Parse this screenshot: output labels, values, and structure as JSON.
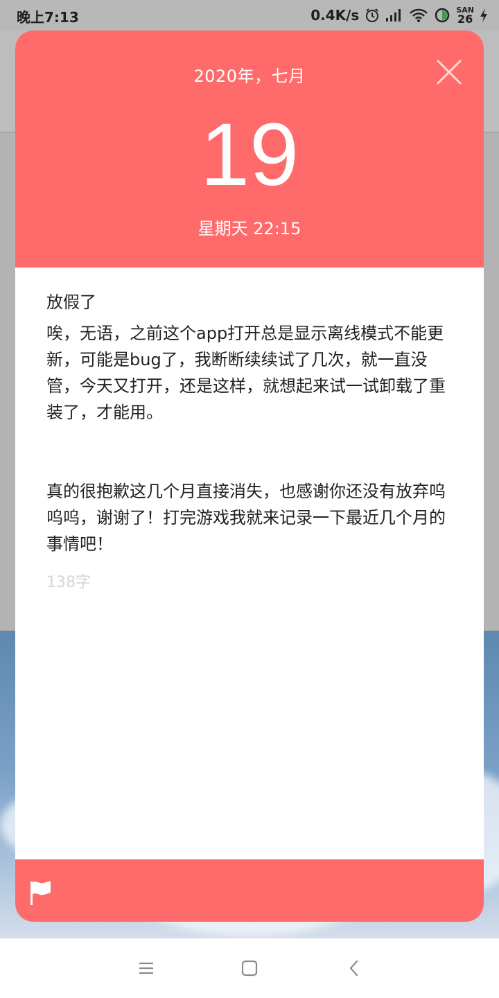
{
  "status_bar": {
    "time": "晚上7:13",
    "network_speed": "0.4K/s",
    "battery_label": "SAN",
    "battery_level": "26",
    "icons": [
      "alarm-icon",
      "signal-icon",
      "wifi-icon",
      "battery-icon",
      "charging-icon"
    ]
  },
  "dialog": {
    "header": {
      "month": "2020年，七月",
      "day": "19",
      "weekday_time": "星期天 22:15",
      "close_icon": "close-icon"
    },
    "entry": {
      "title": "放假了",
      "body": "唉，无语，之前这个app打开总是显示离线模式不能更新，可能是bug了，我断断续续试了几次，就一直没管，今天又打开，还是这样，就想起来试一试卸载了重装了，才能用。\n\n\n真的很抱歉这几个月直接消失，也感谢你还没有放弃呜呜呜，谢谢了！打完游戏我就来记录一下最近几个月的事情吧！",
      "word_count": "138字"
    },
    "footer": {
      "flag_icon": "flag-icon"
    }
  },
  "nav_bar": {
    "icons": [
      "menu-icon",
      "home-icon",
      "back-icon"
    ]
  },
  "colors": {
    "accent": "#ff6b6b",
    "text": "#222222",
    "muted": "#d5d5d5"
  }
}
